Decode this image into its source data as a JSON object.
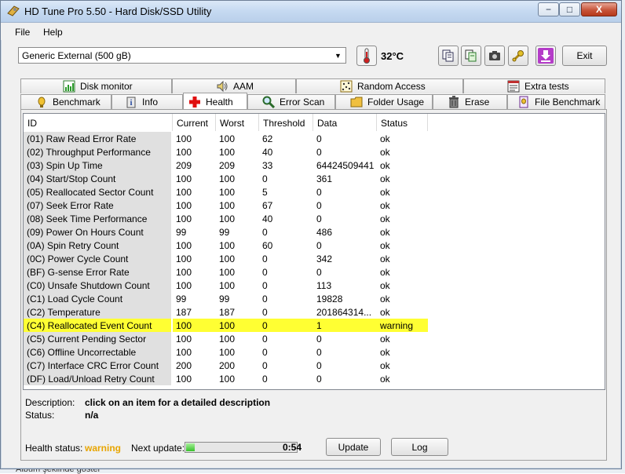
{
  "window": {
    "title": "HD Tune Pro 5.50 - Hard Disk/SSD Utility",
    "minimize": "−",
    "maximize": "□",
    "close": "X"
  },
  "menu": {
    "file": "File",
    "help": "Help"
  },
  "toolbar": {
    "drive": "Generic External (500 gB)",
    "temperature": "32°C",
    "exit": "Exit"
  },
  "tabs_top": [
    {
      "label": "Disk monitor",
      "icon": "disk-monitor-icon"
    },
    {
      "label": "AAM",
      "icon": "speaker-icon"
    },
    {
      "label": "Random Access",
      "icon": "random-access-icon"
    },
    {
      "label": "Extra tests",
      "icon": "extra-tests-icon"
    }
  ],
  "tabs_bottom": [
    {
      "label": "Benchmark",
      "icon": "benchmark-icon"
    },
    {
      "label": "Info",
      "icon": "info-icon"
    },
    {
      "label": "Health",
      "icon": "health-cross-icon"
    },
    {
      "label": "Error Scan",
      "icon": "magnifier-icon"
    },
    {
      "label": "Folder Usage",
      "icon": "folder-icon"
    },
    {
      "label": "Erase",
      "icon": "trash-icon"
    },
    {
      "label": "File Benchmark",
      "icon": "file-benchmark-icon"
    }
  ],
  "table": {
    "columns": [
      "ID",
      "Current",
      "Worst",
      "Threshold",
      "Data",
      "Status"
    ],
    "rows": [
      [
        "(01) Raw Read Error Rate",
        "100",
        "100",
        "62",
        "0",
        "ok"
      ],
      [
        "(02) Throughput Performance",
        "100",
        "100",
        "40",
        "0",
        "ok"
      ],
      [
        "(03) Spin Up Time",
        "209",
        "209",
        "33",
        "64424509441",
        "ok"
      ],
      [
        "(04) Start/Stop Count",
        "100",
        "100",
        "0",
        "361",
        "ok"
      ],
      [
        "(05) Reallocated Sector Count",
        "100",
        "100",
        "5",
        "0",
        "ok"
      ],
      [
        "(07) Seek Error Rate",
        "100",
        "100",
        "67",
        "0",
        "ok"
      ],
      [
        "(08) Seek Time Performance",
        "100",
        "100",
        "40",
        "0",
        "ok"
      ],
      [
        "(09) Power On Hours Count",
        "99",
        "99",
        "0",
        "486",
        "ok"
      ],
      [
        "(0A) Spin Retry Count",
        "100",
        "100",
        "60",
        "0",
        "ok"
      ],
      [
        "(0C) Power Cycle Count",
        "100",
        "100",
        "0",
        "342",
        "ok"
      ],
      [
        "(BF) G-sense Error Rate",
        "100",
        "100",
        "0",
        "0",
        "ok"
      ],
      [
        "(C0) Unsafe Shutdown Count",
        "100",
        "100",
        "0",
        "113",
        "ok"
      ],
      [
        "(C1) Load Cycle Count",
        "99",
        "99",
        "0",
        "19828",
        "ok"
      ],
      [
        "(C2) Temperature",
        "187",
        "187",
        "0",
        "201864314...",
        "ok"
      ],
      [
        "(C4) Reallocated Event Count",
        "100",
        "100",
        "0",
        "1",
        "warning"
      ],
      [
        "(C5) Current Pending Sector",
        "100",
        "100",
        "0",
        "0",
        "ok"
      ],
      [
        "(C6) Offline Uncorrectable",
        "100",
        "100",
        "0",
        "0",
        "ok"
      ],
      [
        "(C7) Interface CRC Error Count",
        "200",
        "200",
        "0",
        "0",
        "ok"
      ],
      [
        "(DF) Load/Unload Retry Count",
        "100",
        "100",
        "0",
        "0",
        "ok"
      ]
    ],
    "highlight_color": "#ffff33"
  },
  "description": {
    "label": "Description:",
    "value": "click on an item for a detailed description"
  },
  "status": {
    "label": "Status:",
    "value": "n/a"
  },
  "footer": {
    "health_label": "Health status:",
    "health_value": "warning",
    "health_color": "#e8a500",
    "next_update_label": "Next update:",
    "timer": "0:54",
    "update_progress": 0.08,
    "update_button": "Update",
    "log_button": "Log"
  },
  "background": {
    "partial_text": "Albüm şeklinde göster"
  }
}
